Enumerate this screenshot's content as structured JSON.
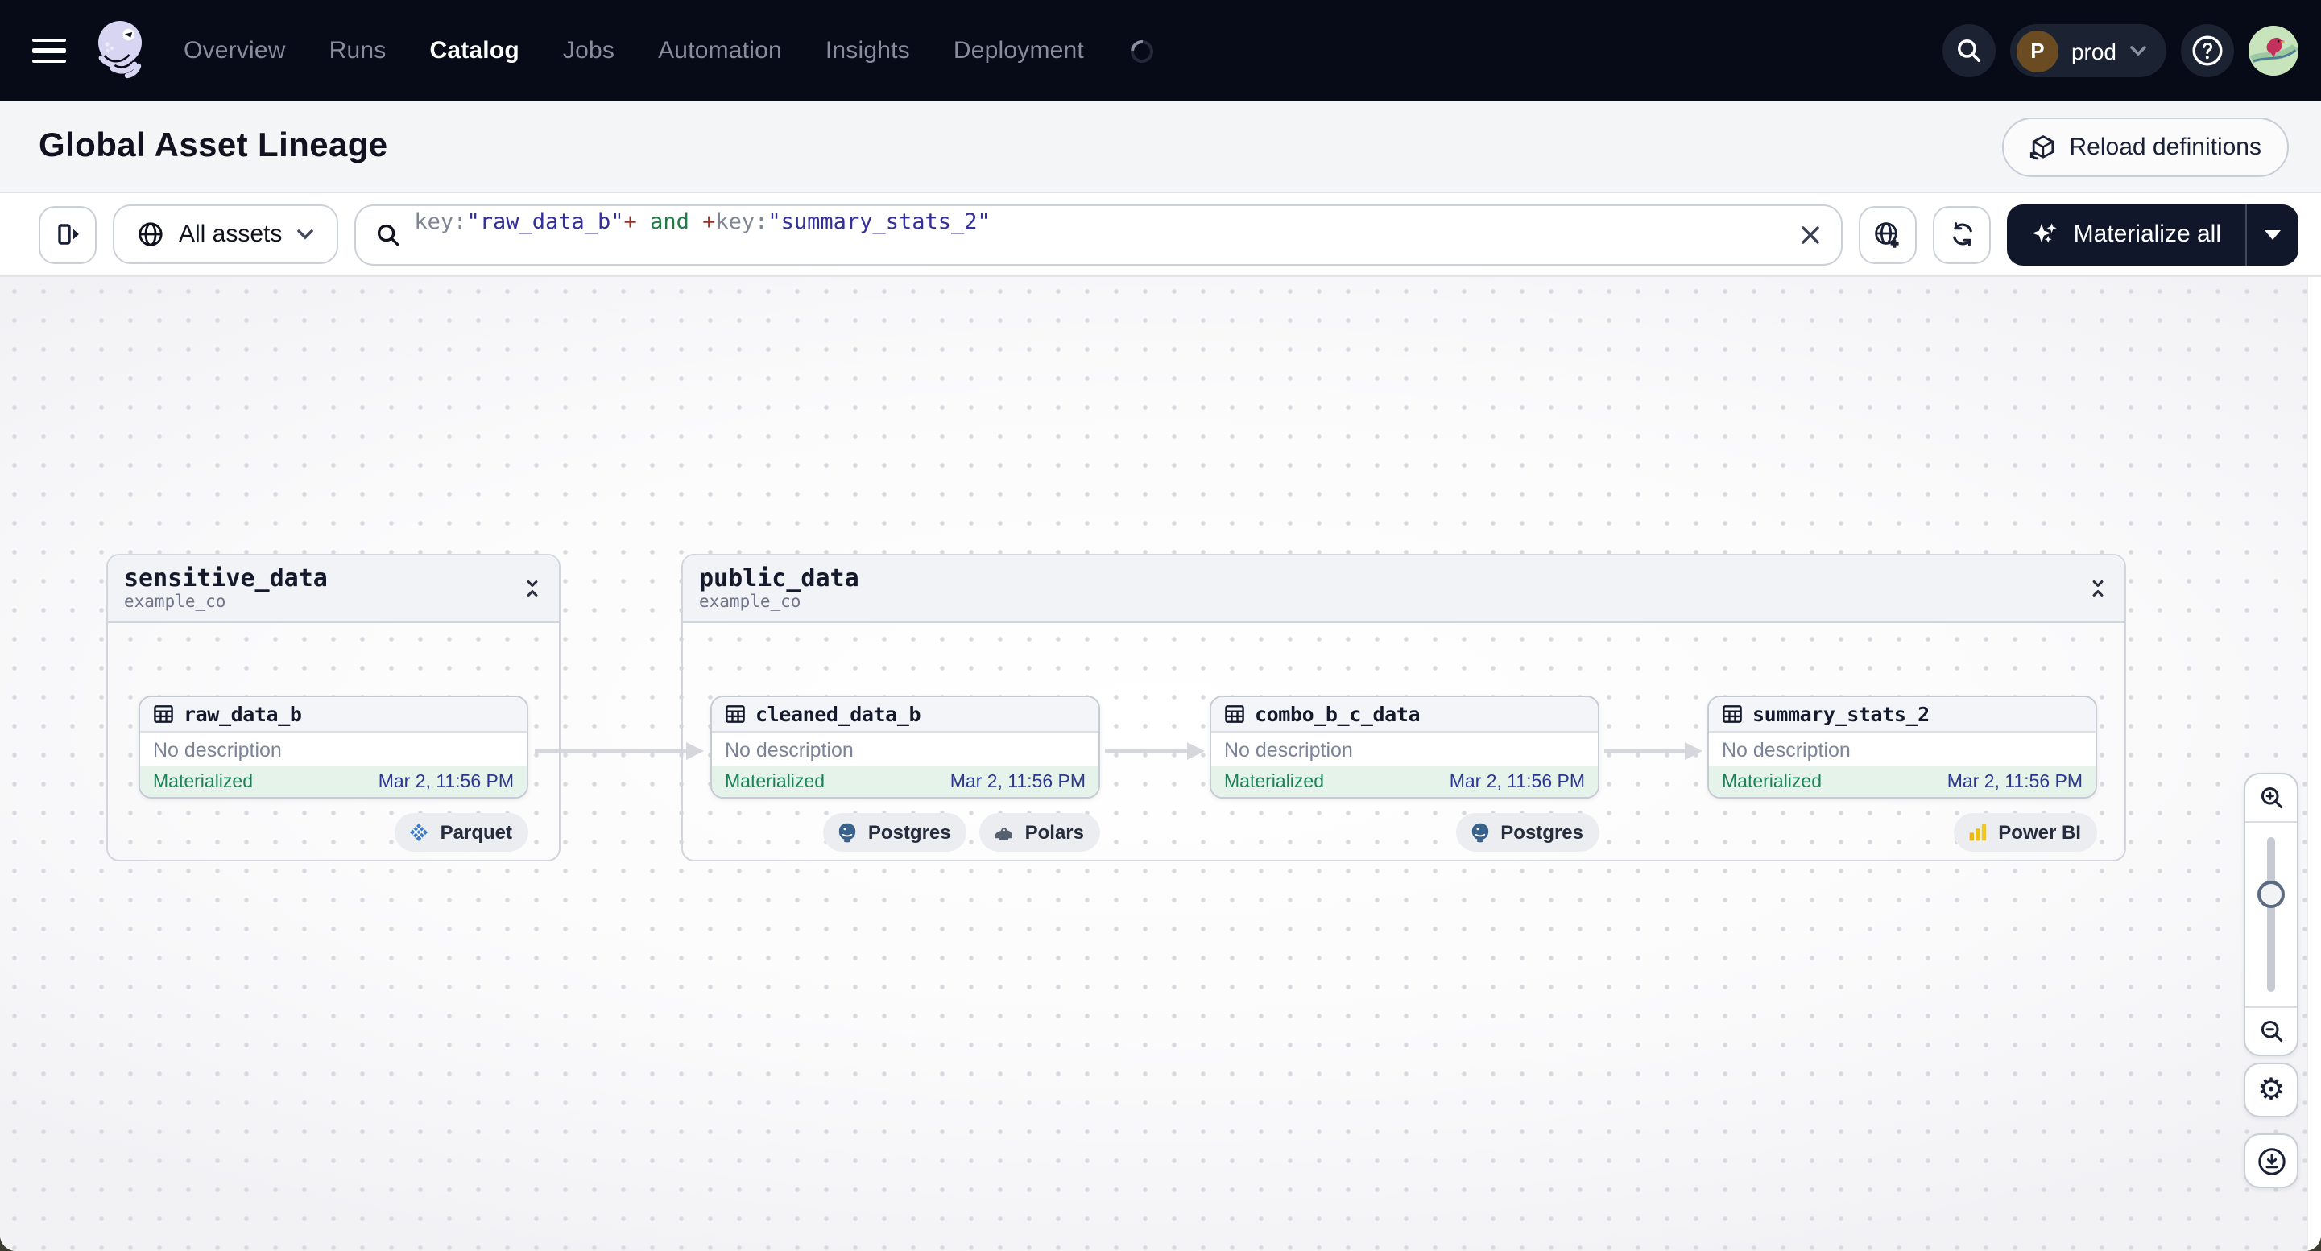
{
  "nav": {
    "items": [
      "Overview",
      "Runs",
      "Catalog",
      "Jobs",
      "Automation",
      "Insights",
      "Deployment"
    ],
    "active_item": "Catalog",
    "environment": {
      "initial": "P",
      "name": "prod"
    },
    "help_label": "?"
  },
  "header": {
    "title": "Global Asset Lineage",
    "reload_button": "Reload definitions"
  },
  "toolbar": {
    "scope_button": "All assets",
    "materialize_button": "Materialize all",
    "query": {
      "segments": [
        {
          "text": "key:"
        },
        {
          "text": "\"raw_data_b\""
        },
        {
          "text": "+"
        },
        {
          "text": " and "
        },
        {
          "text": "+"
        },
        {
          "text": "key:"
        },
        {
          "text": "\"summary_stats_2\""
        }
      ]
    }
  },
  "graph": {
    "groups": [
      {
        "name": "sensitive_data",
        "location": "example_co"
      },
      {
        "name": "public_data",
        "location": "example_co"
      }
    ],
    "assets": [
      {
        "name": "raw_data_b",
        "description": "No description",
        "status": "Materialized",
        "timestamp": "Mar 2, 11:56 PM",
        "tags": [
          "Parquet"
        ]
      },
      {
        "name": "cleaned_data_b",
        "description": "No description",
        "status": "Materialized",
        "timestamp": "Mar 2, 11:56 PM",
        "tags": [
          "Postgres",
          "Polars"
        ]
      },
      {
        "name": "combo_b_c_data",
        "description": "No description",
        "status": "Materialized",
        "timestamp": "Mar 2, 11:56 PM",
        "tags": [
          "Postgres"
        ]
      },
      {
        "name": "summary_stats_2",
        "description": "No description",
        "status": "Materialized",
        "timestamp": "Mar 2, 11:56 PM",
        "tags": [
          "Power BI"
        ]
      }
    ]
  },
  "colors": {
    "status_materialized": "#1c8159",
    "status_bar_bg": "#e5f3ea",
    "nav_bg": "#070a17",
    "accent_dark": "#10172b",
    "query_string": "#34309b",
    "query_operator": "#9a2f26",
    "query_keyword": "#237a46"
  }
}
